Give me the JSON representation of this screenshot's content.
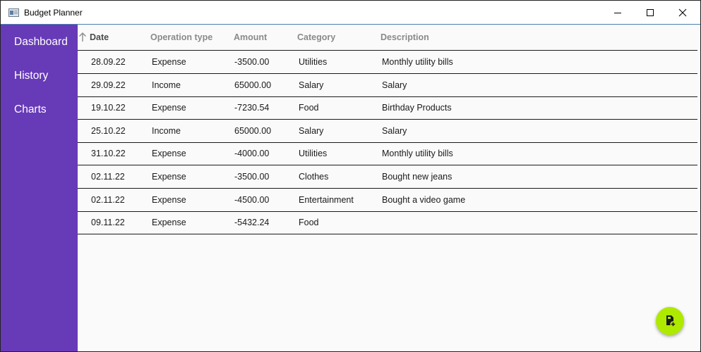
{
  "window": {
    "title": "Budget Planner"
  },
  "sidebar": {
    "items": [
      {
        "label": "Dashboard"
      },
      {
        "label": "History"
      },
      {
        "label": "Charts"
      }
    ]
  },
  "table": {
    "sorted_column": "Date",
    "sort_direction": "ascending",
    "columns": [
      "Date",
      "Operation type",
      "Amount",
      "Category",
      "Description"
    ],
    "rows": [
      {
        "date": "28.09.22",
        "operation_type": "Expense",
        "amount": "-3500.00",
        "category": "Utilities",
        "description": "Monthly utility bills"
      },
      {
        "date": "29.09.22",
        "operation_type": "Income",
        "amount": "65000.00",
        "category": "Salary",
        "description": "Salary"
      },
      {
        "date": "19.10.22",
        "operation_type": "Expense",
        "amount": "-7230.54",
        "category": "Food",
        "description": "Birthday Products"
      },
      {
        "date": "25.10.22",
        "operation_type": "Income",
        "amount": "65000.00",
        "category": "Salary",
        "description": "Salary"
      },
      {
        "date": "31.10.22",
        "operation_type": "Expense",
        "amount": "-4000.00",
        "category": "Utilities",
        "description": "Monthly utility bills"
      },
      {
        "date": "02.11.22",
        "operation_type": "Expense",
        "amount": "-3500.00",
        "category": "Clothes",
        "description": "Bought new jeans"
      },
      {
        "date": "02.11.22",
        "operation_type": "Expense",
        "amount": "-4500.00",
        "category": "Entertainment",
        "description": "Bought a video game"
      },
      {
        "date": "09.11.22",
        "operation_type": "Expense",
        "amount": "-5432.24",
        "category": "Food",
        "description": ""
      }
    ]
  },
  "fab": {
    "icon": "add-document-icon"
  },
  "colors": {
    "sidebar": "#673ab7",
    "fab": "#aeea00",
    "background": "#fafafa"
  }
}
